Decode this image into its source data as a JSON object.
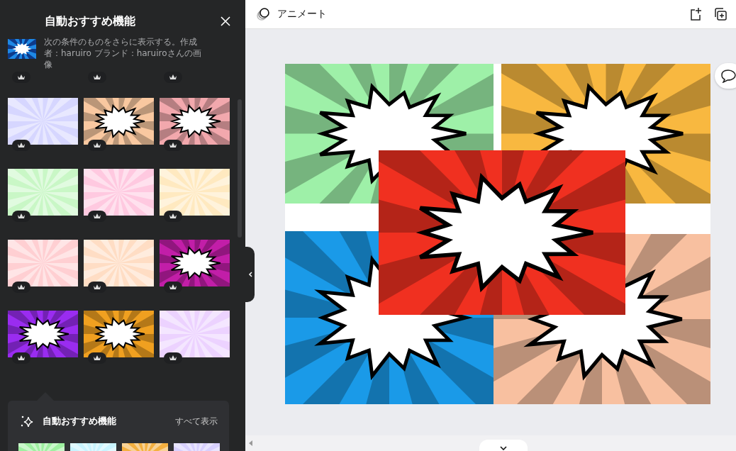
{
  "panel": {
    "title": "自動おすすめ機能",
    "description": "次の条件のものをさらに表示する。作成者：haruiro ブランド：haruiroさんの画像",
    "partial_row": [
      {
        "premium": true
      },
      {
        "premium": true
      },
      {
        "premium": true
      }
    ],
    "thumbnails": [
      {
        "kind": "rays",
        "color": "#d6d6ff",
        "premium": true
      },
      {
        "kind": "burst",
        "color": "#f9c8a0",
        "premium": true
      },
      {
        "kind": "burst",
        "color": "#f2a8ad",
        "premium": true
      },
      {
        "kind": "rays",
        "color": "#c9f7c6",
        "premium": true
      },
      {
        "kind": "rays",
        "color": "#ffc9e0",
        "premium": true
      },
      {
        "kind": "rays",
        "color": "#ffe9c0",
        "premium": true
      },
      {
        "kind": "rays",
        "color": "#ffcfd2",
        "premium": true
      },
      {
        "kind": "rays",
        "color": "#ffddc4",
        "premium": true
      },
      {
        "kind": "burst",
        "color": "#c21ea8",
        "premium": true
      },
      {
        "kind": "burst",
        "color": "#9a2cf0",
        "premium": true
      },
      {
        "kind": "burst",
        "color": "#f0a020",
        "premium": true
      },
      {
        "kind": "rays",
        "color": "#ecd2ff",
        "premium": true
      }
    ],
    "recommend": {
      "title": "自動おすすめ機能",
      "see_all": "すべて表示",
      "previews": [
        {
          "color": "#9ef0a0"
        },
        {
          "color": "#c8f4ff"
        },
        {
          "color": "#f5b040"
        },
        {
          "color": "#d8d0ff"
        }
      ]
    }
  },
  "toolbar": {
    "animate": "アニメート"
  },
  "canvas": {
    "elements": [
      {
        "color": "#9ef0a8"
      },
      {
        "color": "#f8b840"
      },
      {
        "color": "#1a9ae8"
      },
      {
        "color": "#f8c0a0"
      },
      {
        "color": "#f03020"
      }
    ]
  }
}
